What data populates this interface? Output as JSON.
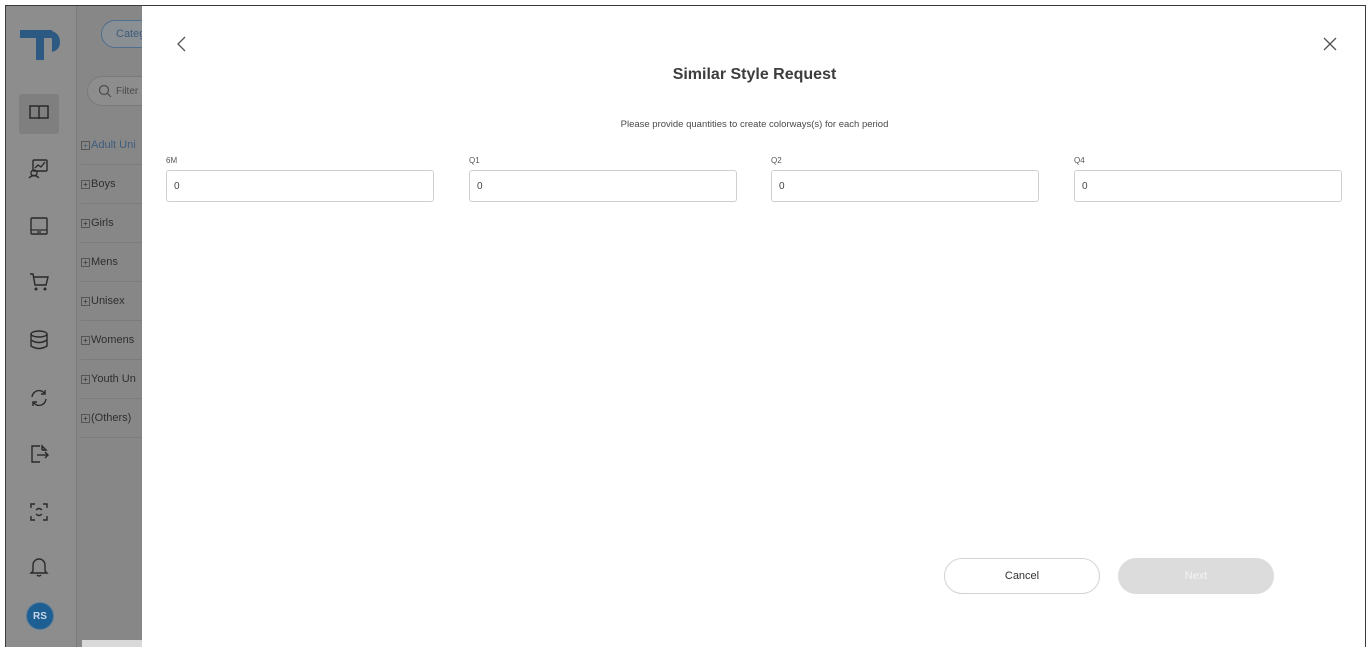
{
  "rail": {
    "items": [
      {
        "icon": "catalog-book-icon"
      },
      {
        "icon": "analytics-chart-icon"
      },
      {
        "icon": "monitor-icon"
      },
      {
        "icon": "cart-icon"
      },
      {
        "icon": "database-icon"
      },
      {
        "icon": "sync-icon"
      },
      {
        "icon": "export-icon"
      },
      {
        "icon": "scan-icon"
      },
      {
        "icon": "bell-icon"
      }
    ],
    "avatar_initials": "RS"
  },
  "category_panel": {
    "category_button_label": "Categ",
    "filter_placeholder": "Filter",
    "tree_items": [
      "Adult Uni",
      "Boys",
      "Girls",
      "Mens",
      "Unisex",
      "Womens",
      "Youth Un",
      "(Others)"
    ]
  },
  "modal": {
    "title": "Similar Style Request",
    "subtitle": "Please provide quantities to create colorways(s) for each period",
    "fields": [
      {
        "label": "6M",
        "value": "0"
      },
      {
        "label": "Q1",
        "value": "0"
      },
      {
        "label": "Q2",
        "value": "0"
      },
      {
        "label": "Q4",
        "value": "0"
      }
    ],
    "cancel_label": "Cancel",
    "next_label": "Next"
  },
  "colors": {
    "overlay_gray": "#8a8a8a",
    "accent_blue": "#1d5e93",
    "next_disabled": "#dcdcdc"
  }
}
